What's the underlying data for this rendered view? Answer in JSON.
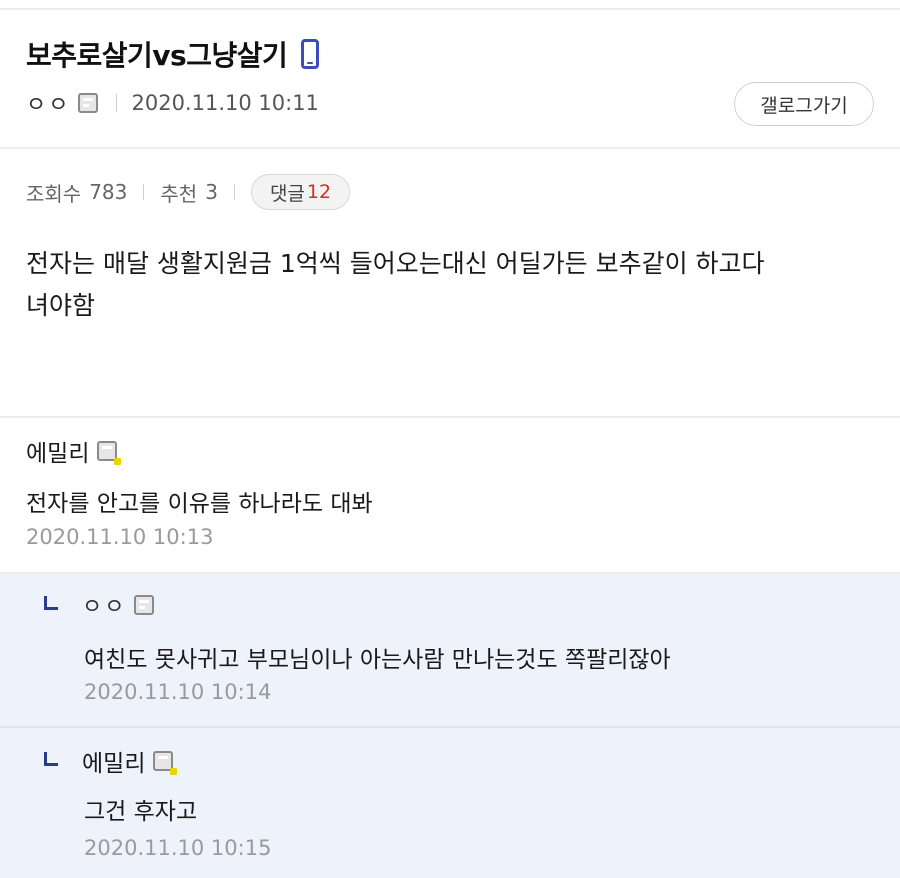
{
  "post": {
    "title": "보추로살기vs그냥살기",
    "author": "ㅇㅇ",
    "date": "2020.11.10 10:11",
    "gallery_button": "갤로그가기",
    "views_label": "조회수",
    "views": "783",
    "recommend_label": "추천",
    "recommend": "3",
    "comments_label": "댓글",
    "comments_count": "12",
    "body_line1": "전자는 매달 생활지원금 1억씩 들어오는대신 어딜가든 보추같이 하고다",
    "body_line2": "녀야함",
    "icons": [
      "mobile-phone-icon",
      "gallog-icon"
    ]
  },
  "comments": [
    {
      "author": "에밀리",
      "text": "전자를 안고를 이유를 하나라도 대봐",
      "date": "2020.11.10 10:13"
    },
    {
      "author": "ㅇㅇ",
      "text": "여친도 못사귀고 부모님이나 아는사람 만나는것도 쪽팔리잖아",
      "date": "2020.11.10 10:14"
    },
    {
      "author": "에밀리",
      "text": "그건 후자고",
      "date": "2020.11.10 10:15"
    }
  ],
  "colors": {
    "accent": "#3b4cc0",
    "comment_count": "#c8322d",
    "reply_bg": "#edf2fb"
  }
}
